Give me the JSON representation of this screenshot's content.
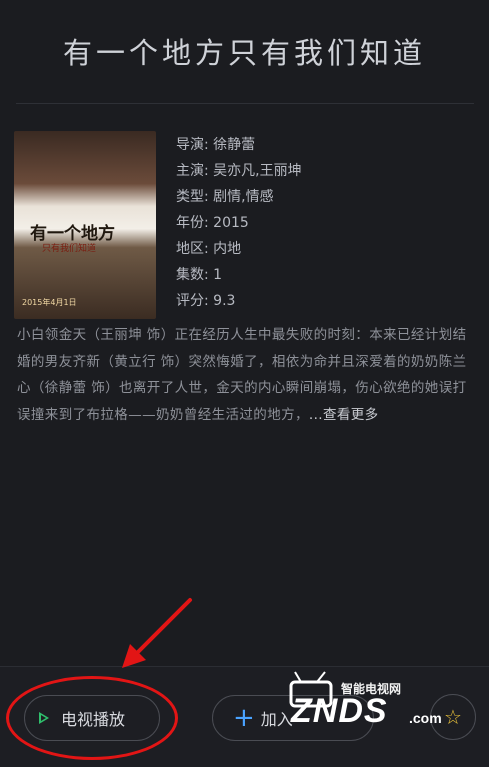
{
  "page_title": "有一个地方只有我们知道",
  "poster": {
    "title_text": "有一个地方",
    "subtitle_text": "只有我们知道",
    "year_text": "2015年4月1日"
  },
  "details": [
    {
      "label": "导演: 徐静蕾"
    },
    {
      "label": "主演: 吴亦凡,王丽坤"
    },
    {
      "label": "类型: 剧情,情感"
    },
    {
      "label": "年份: 2015"
    },
    {
      "label": "地区: 内地"
    },
    {
      "label": "集数: 1"
    },
    {
      "label": "评分: 9.3"
    }
  ],
  "synopsis": {
    "text": "小白领金天（王丽坤 饰）正在经历人生中最失败的时刻：本来已经计划结婚的男友齐新（黄立行 饰）突然悔婚了，相依为命并且深爱着的奶奶陈兰心（徐静蕾 饰）也离开了人世，金天的内心瞬间崩塌，伤心欲绝的她误打误撞来到了布拉格——奶奶曾经生活过的地方，",
    "more_label": "...查看更多"
  },
  "actions": {
    "play_label": "电视播放",
    "add_label": "加入",
    "play_icon": "play-icon",
    "add_icon": "plus-icon",
    "fav_icon": "star-icon",
    "fav_color": "#e9c13a",
    "play_icon_color": "#2fbf6c",
    "add_icon_color": "#4aa3ff"
  },
  "watermark": {
    "cn": "智能电视网",
    "en": "ZNDS",
    "suffix": ".com"
  }
}
